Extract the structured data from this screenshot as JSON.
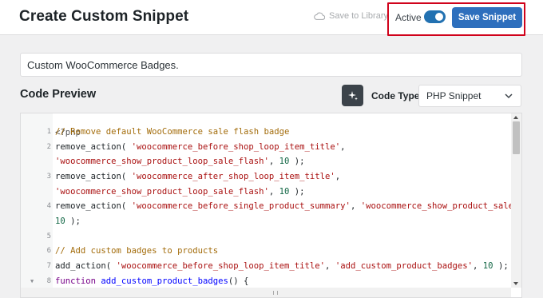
{
  "header": {
    "title": "Create Custom Snippet",
    "save_to_library": "Save to Library",
    "active_label": "Active",
    "active_on": true,
    "save_button": "Save Snippet"
  },
  "snippet": {
    "title_value": "Custom WooCommerce Badges."
  },
  "code_preview": {
    "section_title": "Code Preview",
    "ai_icon": "sparkle-icon",
    "code_type_label": "Code Type",
    "code_type_value": "PHP Snippet"
  },
  "editor": {
    "php_tag": "<?php",
    "lines": [
      {
        "num": "1",
        "parts": [
          {
            "t": "// Remove default WooCommerce sale flash badge",
            "c": "c-comment"
          }
        ]
      },
      {
        "num": "2",
        "parts": [
          {
            "t": "remove_action( ",
            "c": ""
          },
          {
            "t": "'woocommerce_before_shop_loop_item_title'",
            "c": "c-str"
          },
          {
            "t": ",",
            "c": ""
          }
        ]
      },
      {
        "num": "",
        "parts": [
          {
            "t": "'woocommerce_show_product_loop_sale_flash'",
            "c": "c-str"
          },
          {
            "t": ", ",
            "c": ""
          },
          {
            "t": "10",
            "c": "c-num"
          },
          {
            "t": " );",
            "c": ""
          }
        ]
      },
      {
        "num": "3",
        "parts": [
          {
            "t": "remove_action( ",
            "c": ""
          },
          {
            "t": "'woocommerce_after_shop_loop_item_title'",
            "c": "c-str"
          },
          {
            "t": ",",
            "c": ""
          }
        ]
      },
      {
        "num": "",
        "parts": [
          {
            "t": "'woocommerce_show_product_loop_sale_flash'",
            "c": "c-str"
          },
          {
            "t": ", ",
            "c": ""
          },
          {
            "t": "10",
            "c": "c-num"
          },
          {
            "t": " );",
            "c": ""
          }
        ]
      },
      {
        "num": "4",
        "parts": [
          {
            "t": "remove_action( ",
            "c": ""
          },
          {
            "t": "'woocommerce_before_single_product_summary'",
            "c": "c-str"
          },
          {
            "t": ", ",
            "c": ""
          },
          {
            "t": "'woocommerce_show_product_sale_flash'",
            "c": "c-str"
          },
          {
            "t": ",",
            "c": ""
          }
        ]
      },
      {
        "num": "",
        "parts": [
          {
            "t": "10",
            "c": "c-num"
          },
          {
            "t": " );",
            "c": ""
          }
        ]
      },
      {
        "num": "5",
        "parts": []
      },
      {
        "num": "6",
        "parts": [
          {
            "t": "// Add custom badges to products",
            "c": "c-comment"
          }
        ]
      },
      {
        "num": "7",
        "parts": [
          {
            "t": "add_action( ",
            "c": ""
          },
          {
            "t": "'woocommerce_before_shop_loop_item_title'",
            "c": "c-str"
          },
          {
            "t": ", ",
            "c": ""
          },
          {
            "t": "'add_custom_product_badges'",
            "c": "c-str"
          },
          {
            "t": ", ",
            "c": ""
          },
          {
            "t": "10",
            "c": "c-num"
          },
          {
            "t": " );",
            "c": ""
          }
        ]
      },
      {
        "num": "8",
        "fold": true,
        "parts": [
          {
            "t": "function",
            "c": "c-kw"
          },
          {
            "t": " ",
            "c": ""
          },
          {
            "t": "add_custom_product_badges",
            "c": "c-def"
          },
          {
            "t": "() {",
            "c": ""
          }
        ]
      }
    ]
  }
}
